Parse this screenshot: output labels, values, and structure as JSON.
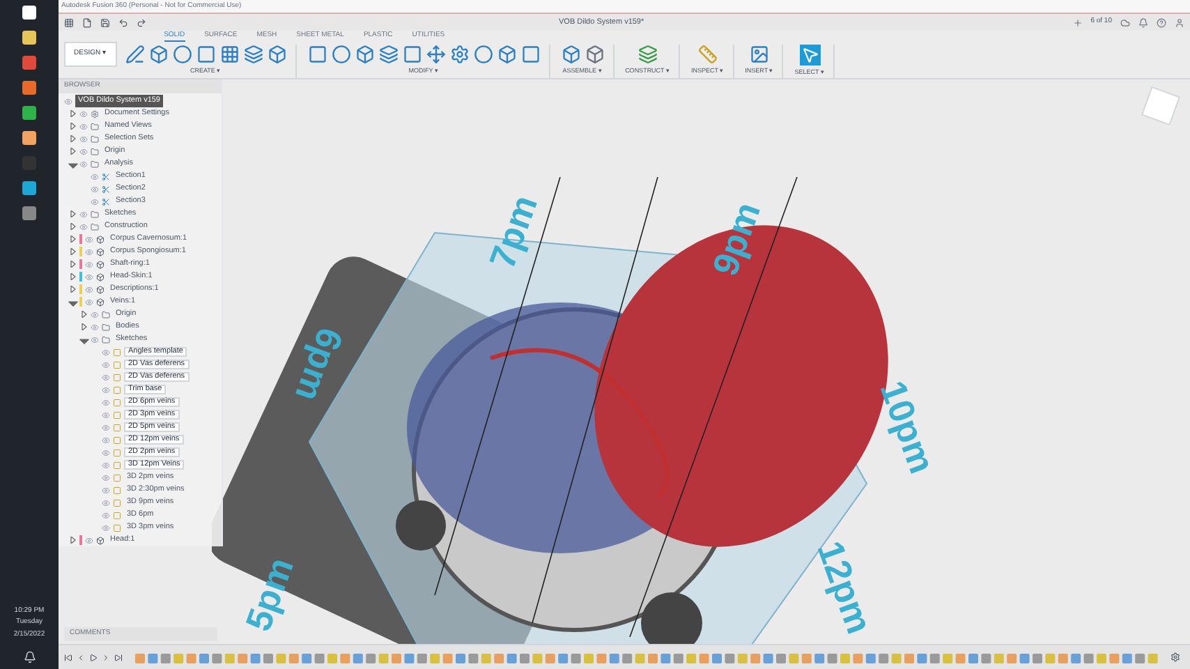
{
  "window": {
    "title": "Autodesk Fusion 360 (Personal - Not for Commercial Use)"
  },
  "document_title": "VOB Dildo System v159*",
  "job_status": "6 of 10",
  "workspace": "DESIGN ▾",
  "tabs": [
    {
      "label": "SOLID",
      "selected": true
    },
    {
      "label": "SURFACE",
      "selected": false
    },
    {
      "label": "MESH",
      "selected": false
    },
    {
      "label": "SHEET METAL",
      "selected": false
    },
    {
      "label": "PLASTIC",
      "selected": false
    },
    {
      "label": "UTILITIES",
      "selected": false
    }
  ],
  "tool_groups": [
    {
      "label": "CREATE ▾",
      "kind": "create"
    },
    {
      "label": "MODIFY ▾",
      "kind": "modify"
    },
    {
      "label": "ASSEMBLE ▾",
      "kind": "assemble"
    },
    {
      "label": "CONSTRUCT ▾",
      "kind": "construct"
    },
    {
      "label": "INSPECT ▾",
      "kind": "inspect"
    },
    {
      "label": "INSERT ▾",
      "kind": "insert"
    },
    {
      "label": "SELECT ▾",
      "kind": "select"
    }
  ],
  "browser": {
    "title": "BROWSER",
    "root": {
      "label": "VOB Dildo System v159",
      "selected": true,
      "children": [
        {
          "label": "Document Settings",
          "kind": "settings",
          "expanded": false
        },
        {
          "label": "Named Views",
          "kind": "folder",
          "expanded": false
        },
        {
          "label": "Selection Sets",
          "kind": "folder",
          "expanded": false
        },
        {
          "label": "Origin",
          "kind": "folder",
          "expanded": false
        },
        {
          "label": "Analysis",
          "kind": "folder",
          "expanded": true,
          "children": [
            {
              "label": "Section1",
              "kind": "section"
            },
            {
              "label": "Section2",
              "kind": "section"
            },
            {
              "label": "Section3",
              "kind": "section"
            }
          ]
        },
        {
          "label": "Sketches",
          "kind": "folder",
          "expanded": false
        },
        {
          "label": "Construction",
          "kind": "folder",
          "expanded": false
        },
        {
          "label": "Corpus Cavernosum:1",
          "kind": "component",
          "expanded": false,
          "color": "#e07a9a"
        },
        {
          "label": "Corpus Spongiosum:1",
          "kind": "component",
          "expanded": false,
          "color": "#e8d060"
        },
        {
          "label": "Shaft-ring:1",
          "kind": "component",
          "expanded": false,
          "color": "#e07a9a"
        },
        {
          "label": "Head-Skin:1",
          "kind": "component",
          "expanded": false,
          "color": "#40c0d0"
        },
        {
          "label": "Descriptions:1",
          "kind": "component",
          "expanded": false,
          "color": "#e8d060"
        },
        {
          "label": "Veins:1",
          "kind": "component",
          "expanded": true,
          "color": "#e8d060",
          "children": [
            {
              "label": "Origin",
              "kind": "folder",
              "expanded": false
            },
            {
              "label": "Bodies",
              "kind": "folder",
              "expanded": false
            },
            {
              "label": "Sketches",
              "kind": "folder",
              "expanded": true,
              "children": [
                {
                  "label": "Angles template",
                  "kind": "sketch",
                  "selected": true
                },
                {
                  "label": "2D Vas deferens",
                  "kind": "sketch",
                  "selected": true
                },
                {
                  "label": "2D Vas deferens",
                  "kind": "sketch",
                  "selected": true
                },
                {
                  "label": "Trim base",
                  "kind": "sketch",
                  "selected": true
                },
                {
                  "label": "2D 6pm veins",
                  "kind": "sketch",
                  "selected": true
                },
                {
                  "label": "2D 3pm veins",
                  "kind": "sketch",
                  "selected": true
                },
                {
                  "label": "2D 5pm veins",
                  "kind": "sketch",
                  "selected": true
                },
                {
                  "label": "2D 12pm veins",
                  "kind": "sketch",
                  "selected": true
                },
                {
                  "label": "2D 2pm veins",
                  "kind": "sketch",
                  "selected": true
                },
                {
                  "label": "3D 12pm Veins",
                  "kind": "sketch",
                  "selected": true
                },
                {
                  "label": "3D 2pm veins",
                  "kind": "sketch",
                  "selected": false
                },
                {
                  "label": "3D 2:30pm veins",
                  "kind": "sketch",
                  "selected": false
                },
                {
                  "label": "3D 9pm veins",
                  "kind": "sketch",
                  "selected": false
                },
                {
                  "label": "3D 6pm",
                  "kind": "sketch",
                  "selected": false
                },
                {
                  "label": "3D 3pm veins",
                  "kind": "sketch",
                  "selected": false
                }
              ]
            }
          ]
        },
        {
          "label": "Head:1",
          "kind": "component",
          "expanded": false,
          "color": "#e07a9a"
        }
      ]
    }
  },
  "comments": {
    "title": "COMMENTS"
  },
  "scene_labels": [
    "7pm",
    "9pm",
    "6pm",
    "10pm",
    "5pm",
    "12pm"
  ],
  "clock": {
    "time": "10:29 PM",
    "day": "Tuesday",
    "date": "2/15/2022"
  }
}
